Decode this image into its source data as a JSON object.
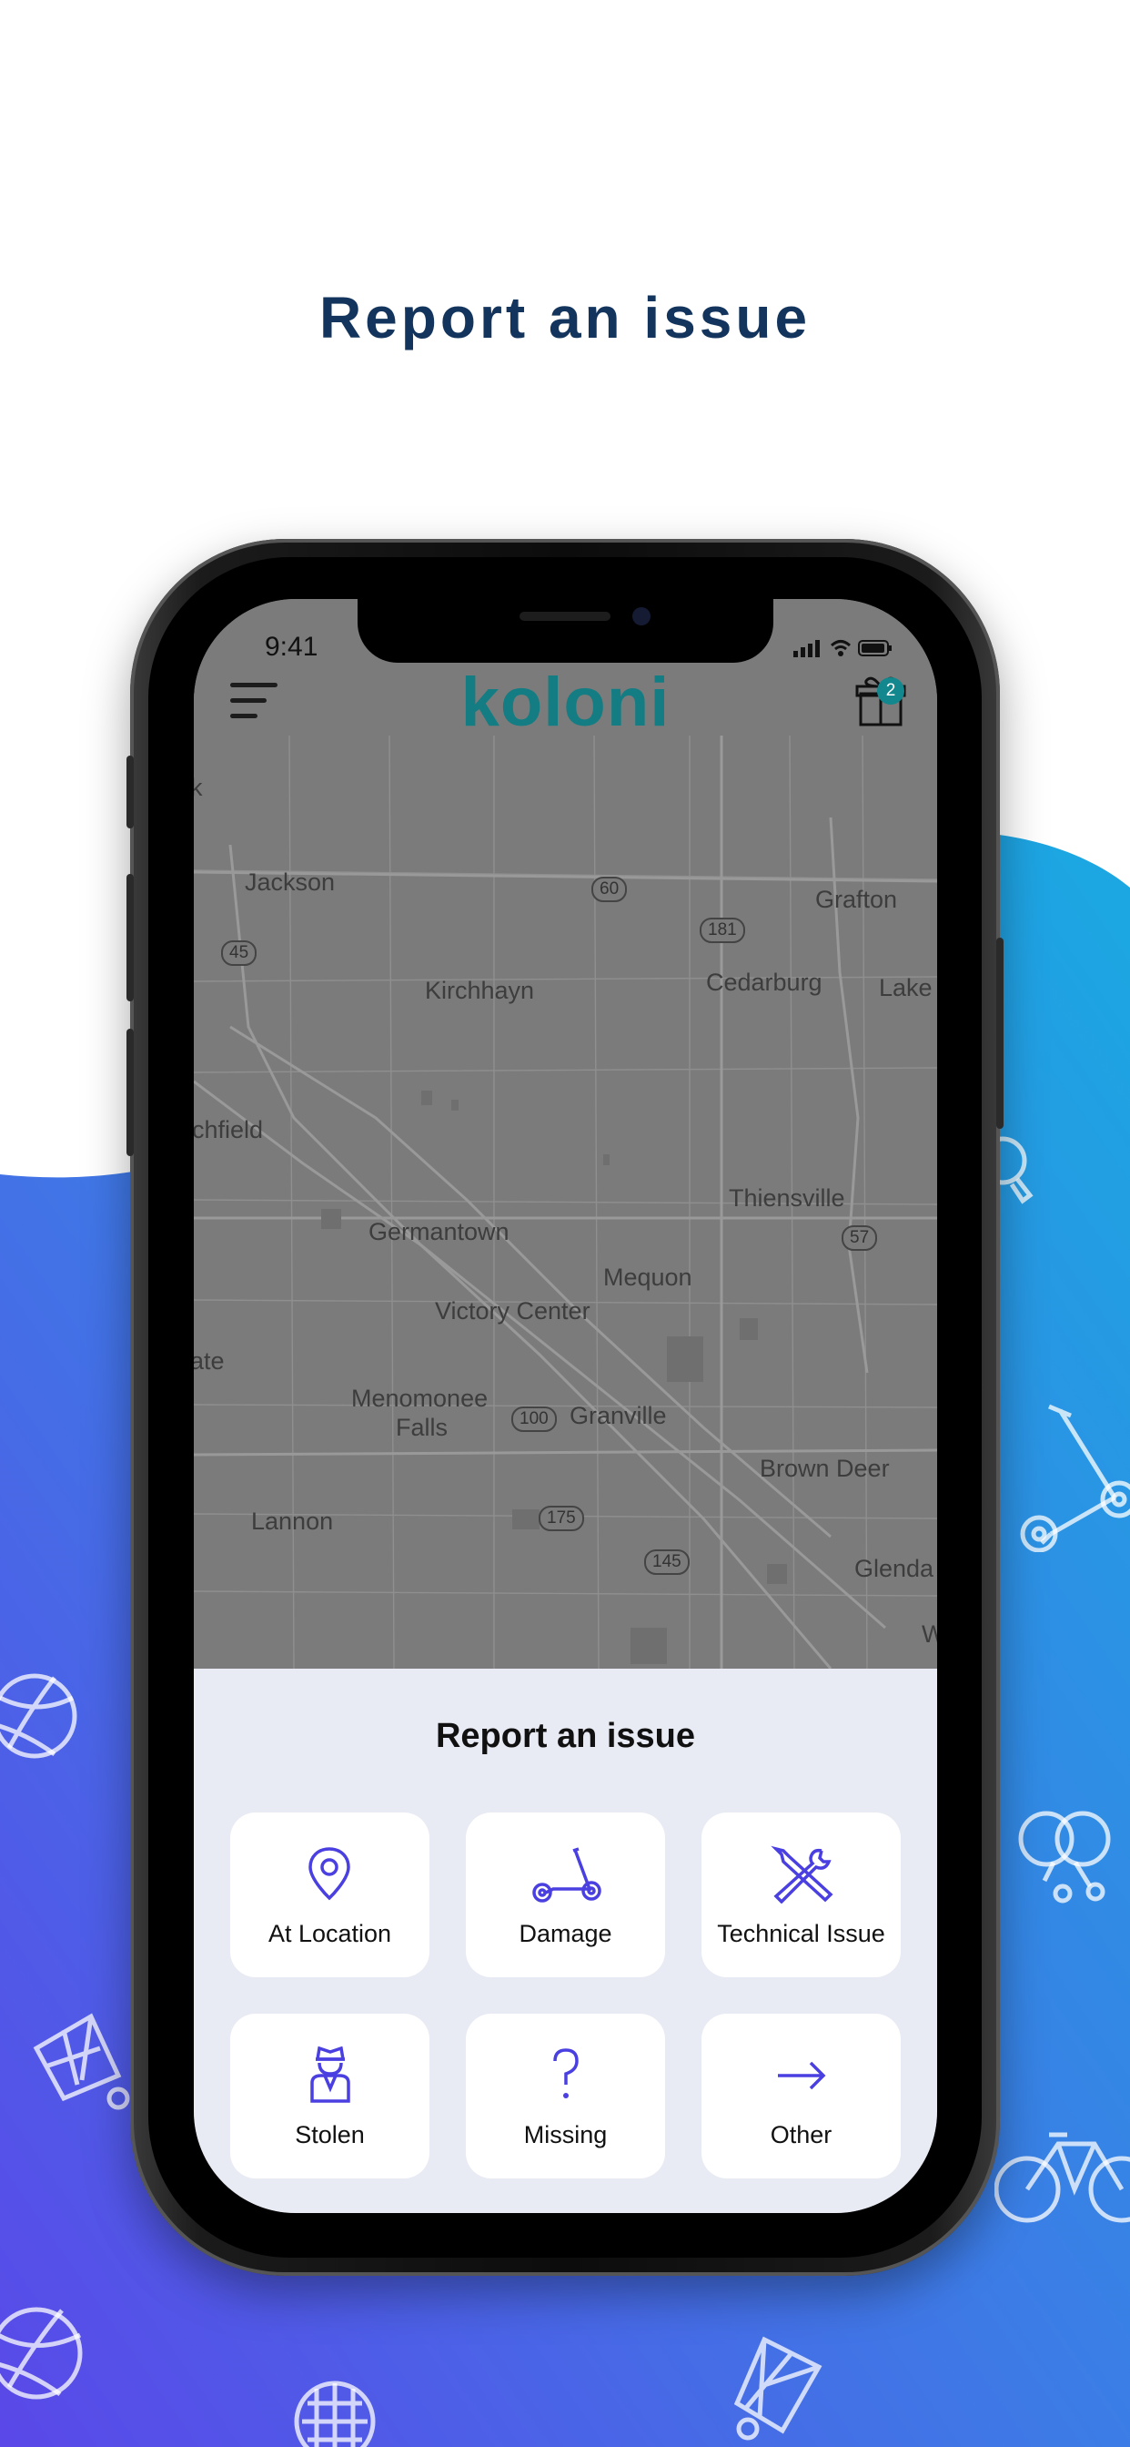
{
  "page_heading": "Report an issue",
  "colors": {
    "heading": "#13345c",
    "brand_teal": "#137d83",
    "accent_icon": "#4a3fe0",
    "wave_top": "#1aa9e2",
    "wave_bottom": "#5a48e8",
    "sheet_bg": "#e9ebf4"
  },
  "status_bar": {
    "time": "9:41",
    "icons": [
      "signal-icon",
      "wifi-icon",
      "battery-icon"
    ]
  },
  "header": {
    "logo_text": "koloni",
    "menu_icon": "hamburger-menu-icon",
    "gift_icon": "gift-icon",
    "gift_badge": "2"
  },
  "map": {
    "places": [
      "k",
      "Jackson",
      "Grafton",
      "Kirchhayn",
      "Cedarburg",
      "Lake",
      "chfield",
      "Thiensville",
      "Germantown",
      "Mequon",
      "Victory Center",
      "ate",
      "Menomonee",
      "Falls",
      "Granville",
      "Brown Deer",
      "Lannon",
      "Glenda",
      "W"
    ],
    "routes": [
      "60",
      "181",
      "45",
      "57",
      "100",
      "175",
      "145"
    ]
  },
  "report_sheet": {
    "title": "Report an issue",
    "options": [
      {
        "label": "At Location",
        "icon": "location-pin-icon"
      },
      {
        "label": "Damage",
        "icon": "scooter-icon"
      },
      {
        "label": "Technical Issue",
        "icon": "tools-icon"
      },
      {
        "label": "Stolen",
        "icon": "thief-icon"
      },
      {
        "label": "Missing",
        "icon": "question-mark-icon"
      },
      {
        "label": "Other",
        "icon": "arrow-right-icon"
      }
    ]
  },
  "background_decorations": [
    "magnifier-icon",
    "scooter-icon",
    "basketball-icon",
    "ping-pong-icon",
    "shuttlecock-icon",
    "bicycle-icon",
    "tennis-racket-icon"
  ]
}
